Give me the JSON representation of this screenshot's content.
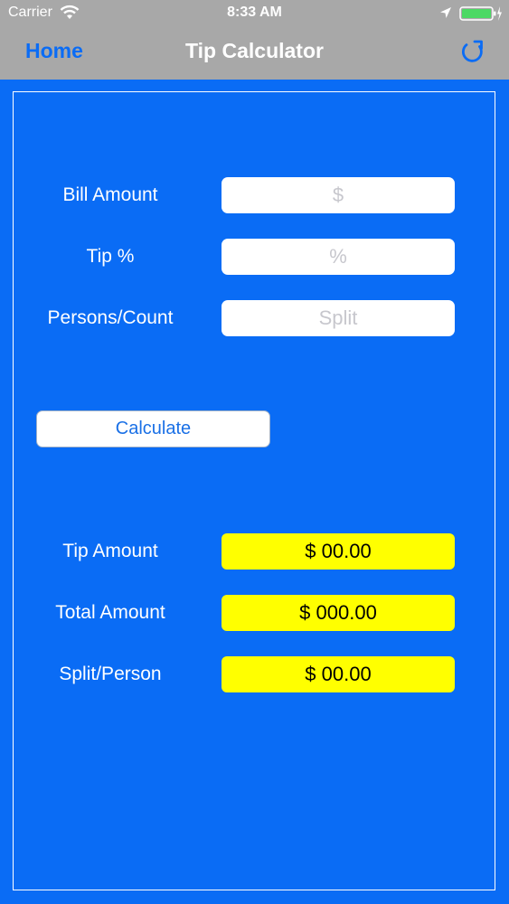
{
  "status_bar": {
    "carrier": "Carrier",
    "time": "8:33 AM"
  },
  "nav": {
    "back_label": "Home",
    "title": "Tip Calculator",
    "refresh_icon": "refresh-icon"
  },
  "form": {
    "bill_amount": {
      "label": "Bill Amount",
      "value": "",
      "placeholder": "$"
    },
    "tip_percent": {
      "label": "Tip %",
      "value": "",
      "placeholder": "%"
    },
    "persons": {
      "label": "Persons/Count",
      "value": "",
      "placeholder": "Split"
    }
  },
  "calculate_label": "Calculate",
  "results": {
    "tip_amount": {
      "label": "Tip Amount",
      "value": "$ 00.00"
    },
    "total_amount": {
      "label": "Total Amount",
      "value": "$ 000.00"
    },
    "split_person": {
      "label": "Split/Person",
      "value": "$ 00.00"
    }
  },
  "colors": {
    "background": "#0a6cf5",
    "chrome": "#a8a8a8",
    "result_fill": "#ffff00",
    "accent": "#0a6cf5"
  }
}
